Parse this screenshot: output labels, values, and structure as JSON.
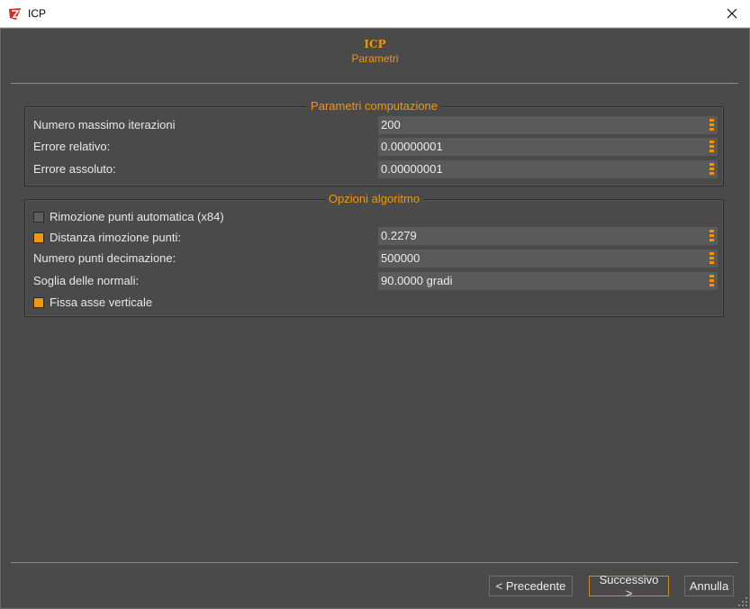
{
  "window": {
    "title": "ICP",
    "close_glyph": "✕"
  },
  "header": {
    "title": "ICP",
    "subtitle": "Parametri"
  },
  "groups": {
    "computation": {
      "title": "Parametri computazione",
      "rows": [
        {
          "label": "Numero massimo iterazioni",
          "value": "200"
        },
        {
          "label": "Errore relativo:",
          "value": "0.00000001"
        },
        {
          "label": "Errore assoluto:",
          "value": "0.00000001"
        }
      ]
    },
    "algorithm": {
      "title": "Opzioni algoritmo",
      "auto_removal": {
        "label": "Rimozione punti automatica (x84)",
        "checked": false
      },
      "distance": {
        "label": "Distanza rimozione punti:",
        "value": "0.2279",
        "checked": true
      },
      "decimation": {
        "label": "Numero punti decimazione:",
        "value": "500000"
      },
      "normals": {
        "label": "Soglia delle normali:",
        "value": "90.0000 gradi"
      },
      "fix_axis": {
        "label": "Fissa asse verticale",
        "checked": true
      }
    }
  },
  "buttons": {
    "previous": "< Precedente",
    "next": "Successivo >",
    "cancel": "Annulla"
  },
  "colors": {
    "accent": "#f0960e",
    "background": "#4a4a4a",
    "field": "#5a5a5a"
  }
}
